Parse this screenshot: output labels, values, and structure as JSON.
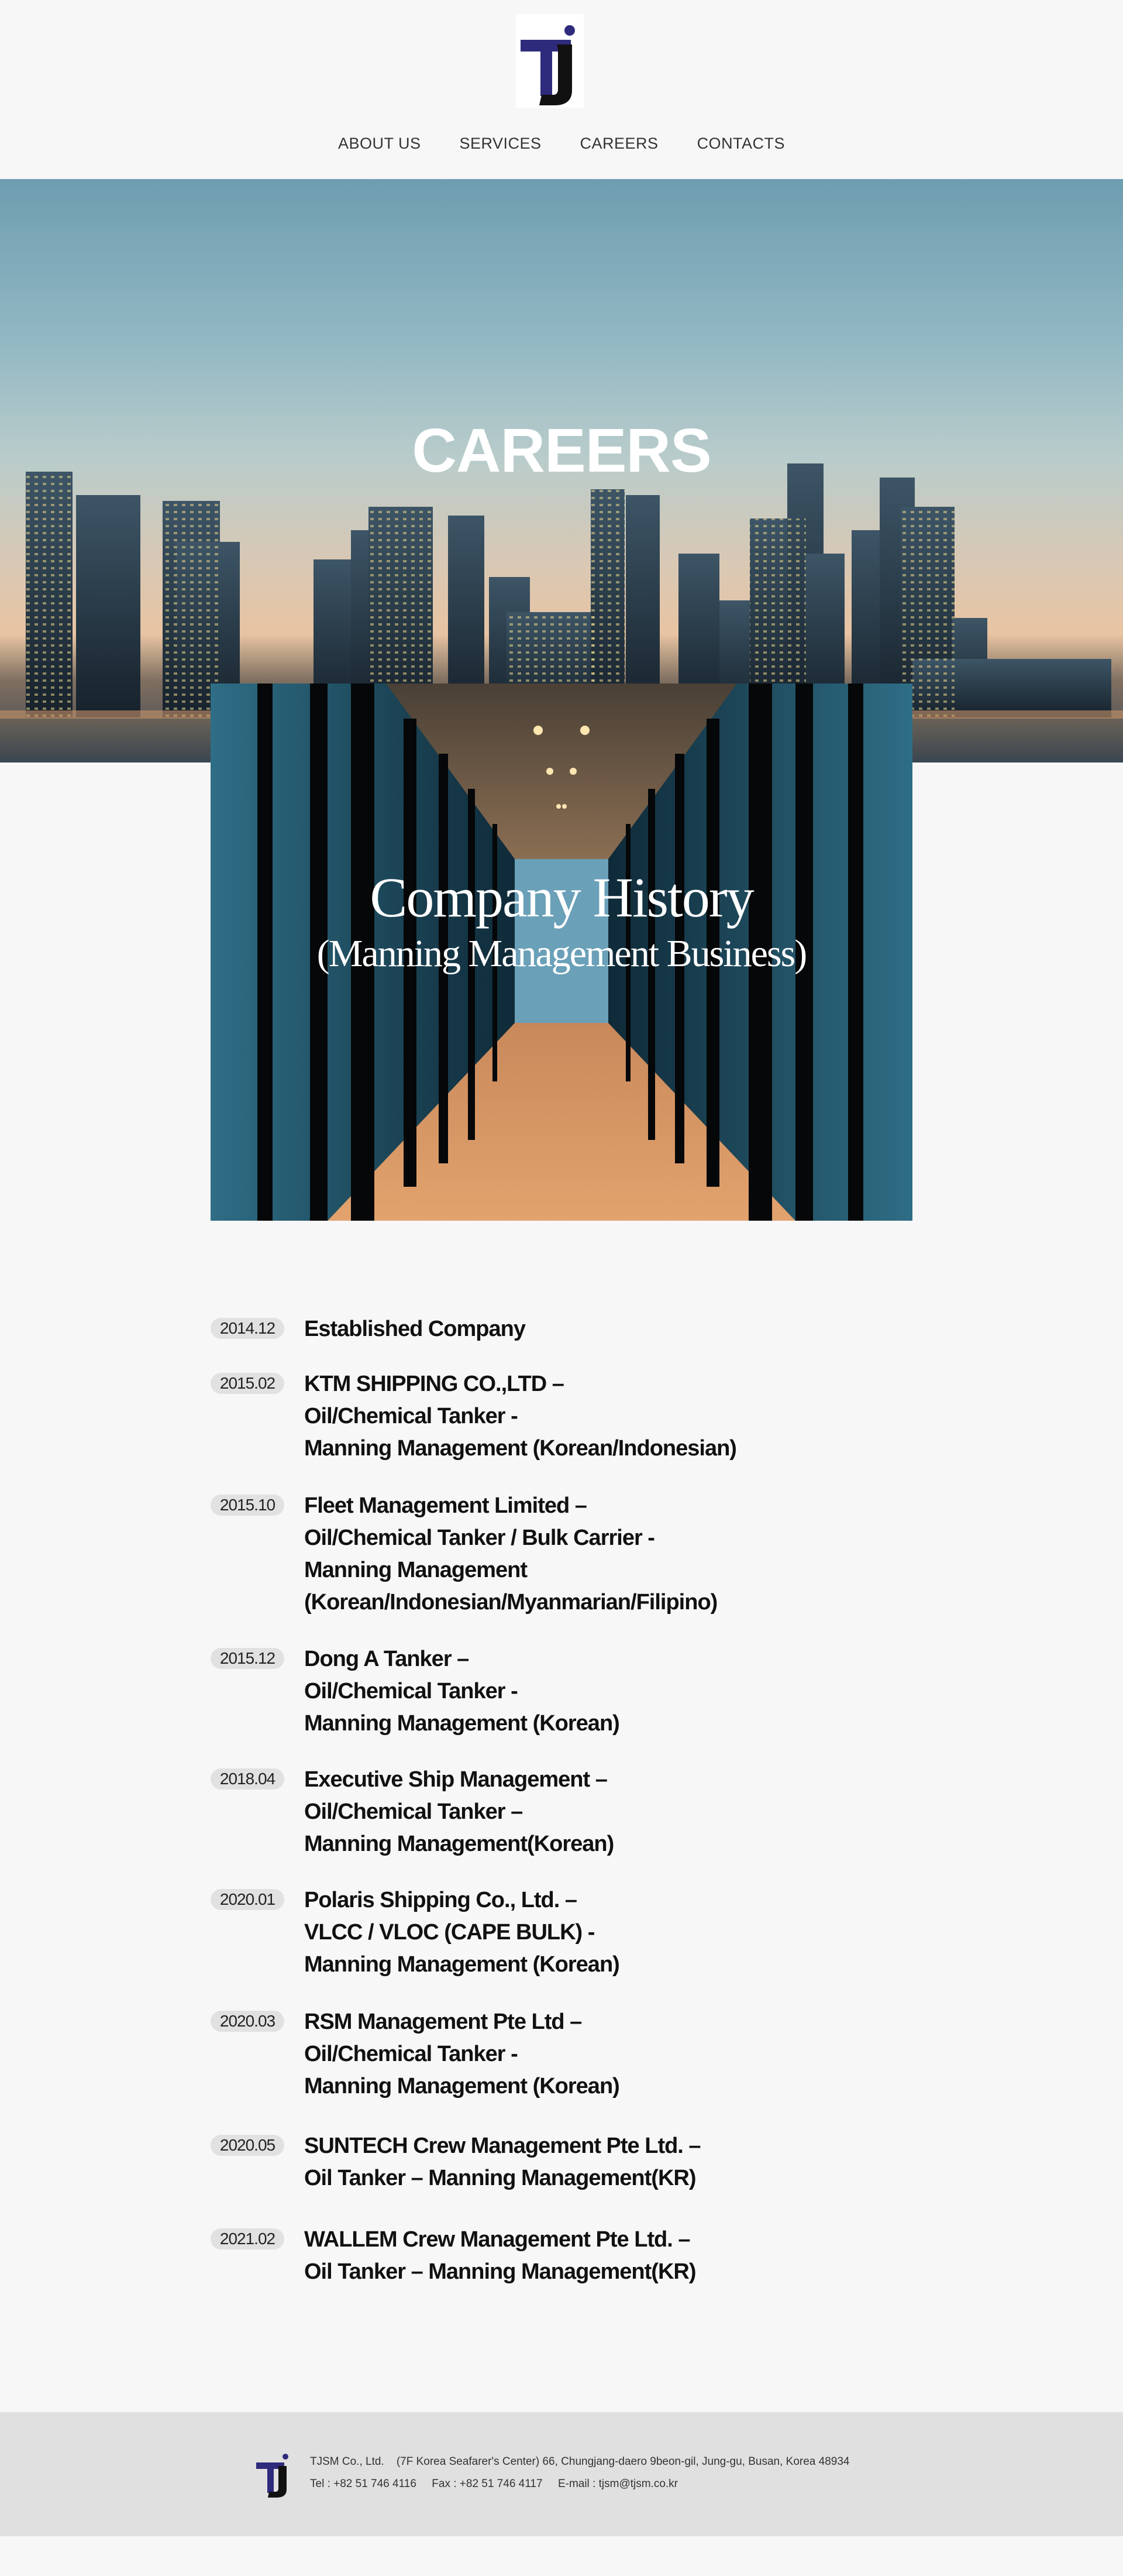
{
  "brand": {
    "logo_letters": "TJ",
    "logo_color_primary": "#2e2a7c",
    "logo_color_secondary": "#111111"
  },
  "nav": {
    "items": [
      {
        "label": "ABOUT US"
      },
      {
        "label": "SERVICES"
      },
      {
        "label": "CAREERS"
      },
      {
        "label": "CONTACTS"
      }
    ]
  },
  "hero": {
    "title": "CAREERS"
  },
  "history": {
    "title": "Company History",
    "subtitle": "(Manning Management Business)"
  },
  "timeline": [
    {
      "date": "2014.12",
      "lines": [
        "Established Company"
      ]
    },
    {
      "date": "2015.02",
      "lines": [
        "KTM SHIPPING CO.,LTD –",
        "Oil/Chemical Tanker  -",
        "Manning Management (Korean/Indonesian)"
      ]
    },
    {
      "date": "2015.10",
      "lines": [
        "Fleet Management Limited –",
        "Oil/Chemical Tanker / Bulk Carrier -",
        "Manning Management",
        "(Korean/Indonesian/Myanmarian/Filipino)"
      ]
    },
    {
      "date": "2015.12",
      "lines": [
        "Dong A Tanker –",
        "Oil/Chemical Tanker -",
        "Manning Management (Korean)"
      ]
    },
    {
      "date": "2018.04",
      "lines": [
        "Executive Ship Management –",
        "Oil/Chemical Tanker –",
        "Manning Management(Korean)"
      ]
    },
    {
      "date": "2020.01",
      "lines": [
        "Polaris Shipping Co., Ltd. –",
        "VLCC / VLOC (CAPE BULK) -",
        "Manning Management (Korean)"
      ]
    },
    {
      "date": "2020.03",
      "lines": [
        "RSM Management Pte Ltd –",
        "Oil/Chemical Tanker -",
        "Manning Management (Korean)"
      ]
    },
    {
      "date": "2020.05",
      "lines": [
        "SUNTECH Crew Management Pte Ltd. –",
        "Oil Tanker – Manning Management(KR)"
      ]
    },
    {
      "date": "2021.02",
      "lines": [
        "WALLEM Crew Management Pte Ltd. –",
        "Oil Tanker – Manning Management(KR)"
      ]
    }
  ],
  "footer": {
    "line1": "TJSM Co., Ltd.    (7F Korea Seafarer's Center) 66, Chungjang-daero 9beon-gil, Jung-gu, Busan, Korea 48934",
    "line2": "Tel : +82 51 746 4116     Fax : +82 51 746 4117     E-mail : tjsm@tjsm.co.kr"
  }
}
